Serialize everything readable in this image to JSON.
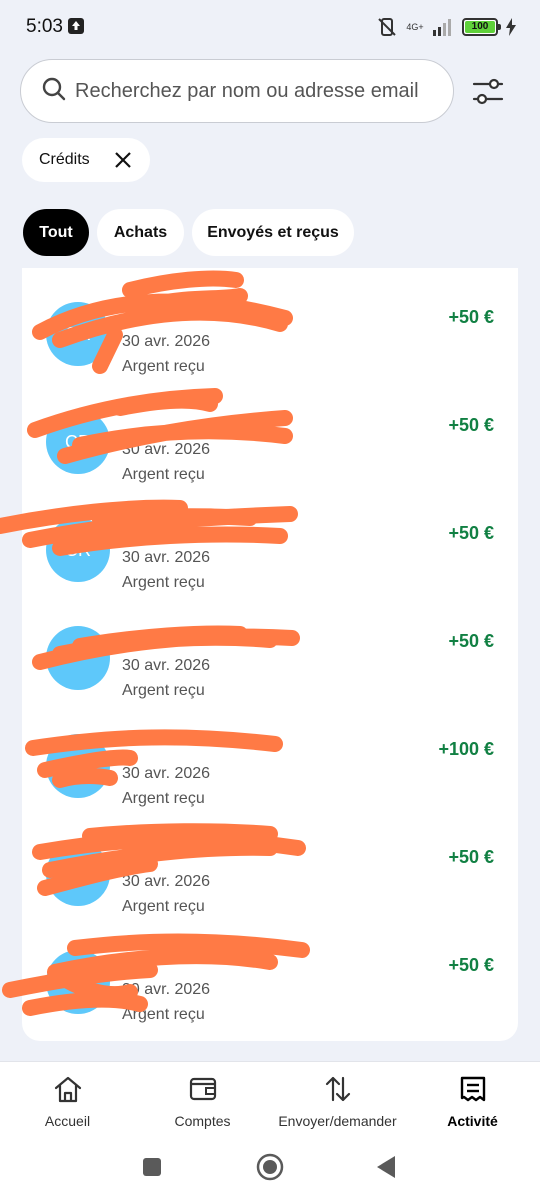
{
  "status_bar": {
    "time": "5:03",
    "network_label": "4G+",
    "battery": "100",
    "icons": [
      "upload-icon",
      "mute-icon",
      "signal-icon",
      "battery-icon",
      "charging-bolt-icon"
    ]
  },
  "search": {
    "placeholder": "Recherchez par nom ou adresse email",
    "icon": "search-icon",
    "filter_icon": "sliders-icon"
  },
  "active_filter": {
    "label": "Crédits",
    "icon": "close-icon"
  },
  "tabs": [
    {
      "label": "Tout",
      "active": true
    },
    {
      "label": "Achats",
      "active": false
    },
    {
      "label": "Envoyés et reçus",
      "active": false
    }
  ],
  "transactions": [
    {
      "initials": "CR",
      "name": "",
      "date": "30 avr. 2026",
      "type": "Argent reçu",
      "amount": "+50 €"
    },
    {
      "initials": "CR",
      "name": "",
      "date": "30 avr. 2026",
      "type": "Argent reçu",
      "amount": "+50 €"
    },
    {
      "initials": "CR",
      "name": "",
      "date": "30 avr. 2026",
      "type": "Argent reçu",
      "amount": "+50 €"
    },
    {
      "initials": "",
      "name": "",
      "date": "30 avr. 2026",
      "type": "Argent reçu",
      "amount": "+50 €"
    },
    {
      "initials": "",
      "name": "",
      "date": "30 avr. 2026",
      "type": "Argent reçu",
      "amount": "+100 €"
    },
    {
      "initials": "",
      "name": "",
      "date": "30 avr. 2026",
      "type": "Argent reçu",
      "amount": "+50 €"
    },
    {
      "initials": "",
      "name": "",
      "date": "30 avr. 2026",
      "type": "Argent reçu",
      "amount": "+50 €"
    }
  ],
  "colors": {
    "accent": "#118043",
    "avatar": "#5ec8fa",
    "redaction": "#ff7a45",
    "background": "#eef1f8"
  },
  "bottom_nav": [
    {
      "label": "Accueil",
      "icon": "home-icon",
      "active": false
    },
    {
      "label": "Comptes",
      "icon": "wallet-icon",
      "active": false
    },
    {
      "label": "Envoyer/demander",
      "icon": "transfer-arrows-icon",
      "active": false
    },
    {
      "label": "Activité",
      "icon": "receipt-icon",
      "active": true
    }
  ],
  "system_nav": {
    "icons": [
      "recents-icon",
      "home-circle-icon",
      "back-icon"
    ]
  }
}
